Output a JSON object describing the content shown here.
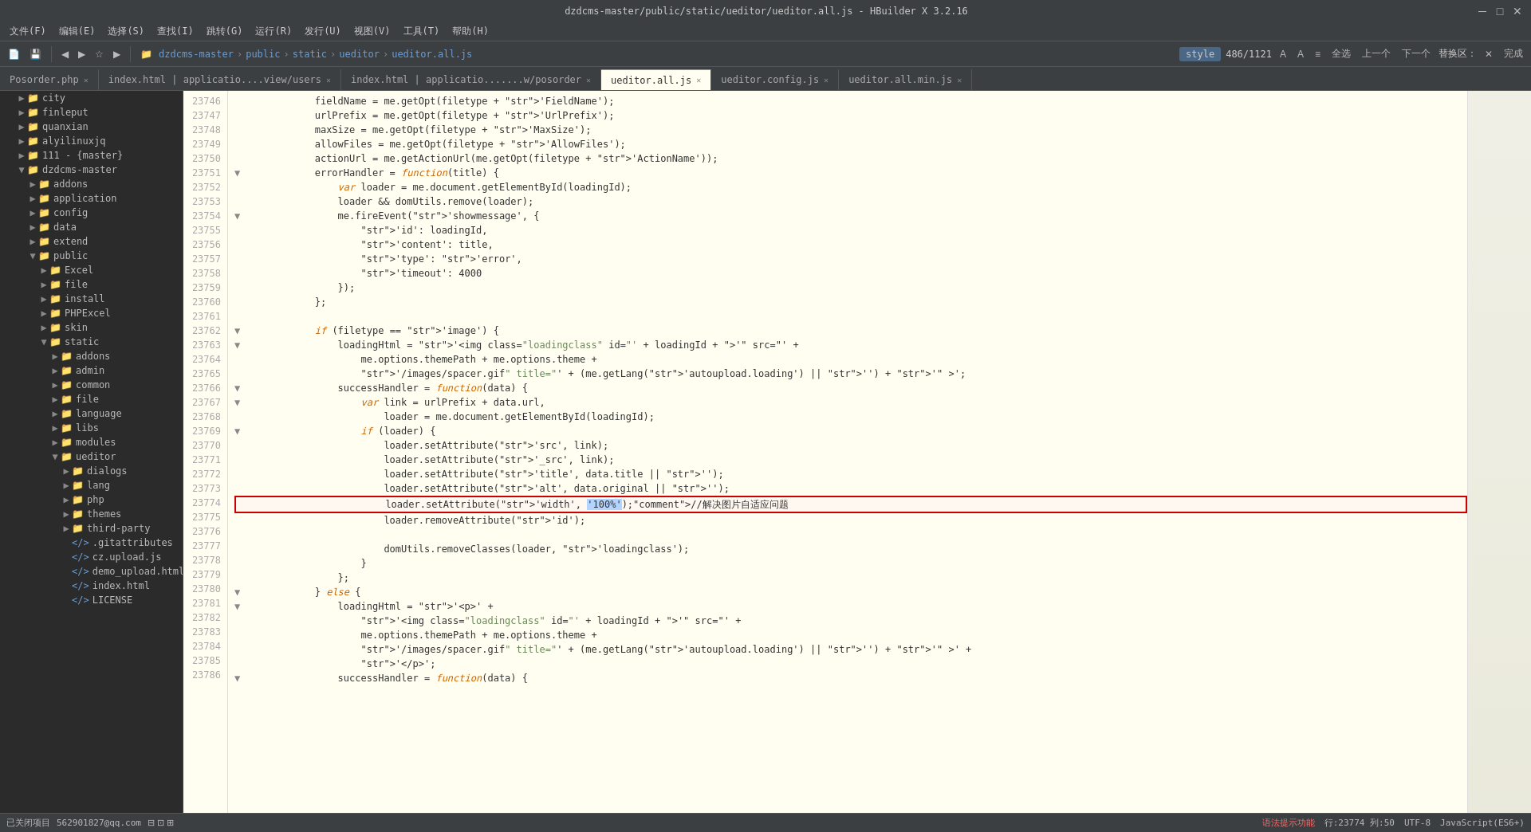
{
  "titleBar": {
    "title": "dzdcms-master/public/static/ueditor/ueditor.all.js - HBuilder X 3.2.16",
    "minimize": "─",
    "maximize": "□",
    "close": "✕"
  },
  "menuBar": {
    "items": [
      "文件(F)",
      "编辑(E)",
      "选择(S)",
      "查找(I)",
      "跳转(G)",
      "运行(R)",
      "发行(U)",
      "视图(V)",
      "工具(T)",
      "帮助(H)"
    ]
  },
  "toolbar": {
    "breadcrumb": [
      "dzdcms-master",
      "public",
      "static",
      "ueditor",
      "ueditor.all.js"
    ],
    "style_tab": "style",
    "position": "486/1121",
    "search_label": "全选",
    "prev_label": "上一个",
    "next_label": "下一个",
    "replace_label": "替换区：",
    "close_label": "✕",
    "finish_label": "完成"
  },
  "tabs": [
    {
      "label": "Posorder.php",
      "active": false
    },
    {
      "label": "index.html | applicatio....view/users",
      "active": false
    },
    {
      "label": "index.html | applicatio.......w/posorder",
      "active": false
    },
    {
      "label": "ueditor.all.js",
      "active": true
    },
    {
      "label": "ueditor.config.js",
      "active": false
    },
    {
      "label": "ueditor.all.min.js",
      "active": false
    }
  ],
  "sidebar": {
    "items": [
      {
        "indent": 1,
        "type": "folder",
        "open": false,
        "label": "city"
      },
      {
        "indent": 1,
        "type": "folder",
        "open": false,
        "label": "finleput"
      },
      {
        "indent": 1,
        "type": "folder",
        "open": false,
        "label": "quanxian"
      },
      {
        "indent": 1,
        "type": "folder",
        "open": false,
        "label": "alyilinuxjq"
      },
      {
        "indent": 1,
        "type": "folder",
        "open": false,
        "label": "111 - {master}"
      },
      {
        "indent": 1,
        "type": "folder",
        "open": true,
        "label": "dzdcms-master"
      },
      {
        "indent": 2,
        "type": "folder",
        "open": false,
        "label": "addons"
      },
      {
        "indent": 2,
        "type": "folder",
        "open": false,
        "label": "application"
      },
      {
        "indent": 2,
        "type": "folder",
        "open": false,
        "label": "config"
      },
      {
        "indent": 2,
        "type": "folder",
        "open": false,
        "label": "data"
      },
      {
        "indent": 2,
        "type": "folder",
        "open": false,
        "label": "extend"
      },
      {
        "indent": 2,
        "type": "folder",
        "open": true,
        "label": "public"
      },
      {
        "indent": 3,
        "type": "folder",
        "open": false,
        "label": "Excel"
      },
      {
        "indent": 3,
        "type": "folder",
        "open": false,
        "label": "file"
      },
      {
        "indent": 3,
        "type": "folder",
        "open": false,
        "label": "install"
      },
      {
        "indent": 3,
        "type": "folder",
        "open": false,
        "label": "PHPExcel"
      },
      {
        "indent": 3,
        "type": "folder",
        "open": false,
        "label": "skin"
      },
      {
        "indent": 3,
        "type": "folder",
        "open": true,
        "label": "static"
      },
      {
        "indent": 4,
        "type": "folder",
        "open": false,
        "label": "addons"
      },
      {
        "indent": 4,
        "type": "folder",
        "open": false,
        "label": "admin"
      },
      {
        "indent": 4,
        "type": "folder",
        "open": false,
        "label": "common"
      },
      {
        "indent": 4,
        "type": "folder",
        "open": false,
        "label": "file"
      },
      {
        "indent": 4,
        "type": "folder",
        "open": false,
        "label": "language"
      },
      {
        "indent": 4,
        "type": "folder",
        "open": false,
        "label": "libs"
      },
      {
        "indent": 4,
        "type": "folder",
        "open": false,
        "label": "modules"
      },
      {
        "indent": 4,
        "type": "folder",
        "open": true,
        "label": "ueditor"
      },
      {
        "indent": 5,
        "type": "folder",
        "open": false,
        "label": "dialogs"
      },
      {
        "indent": 5,
        "type": "folder",
        "open": false,
        "label": "lang"
      },
      {
        "indent": 5,
        "type": "folder",
        "open": false,
        "label": "php"
      },
      {
        "indent": 5,
        "type": "folder",
        "open": false,
        "label": "themes"
      },
      {
        "indent": 5,
        "type": "folder",
        "open": false,
        "label": "third-party"
      },
      {
        "indent": 5,
        "type": "file",
        "open": false,
        "label": ".gitattributes"
      },
      {
        "indent": 5,
        "type": "file",
        "open": false,
        "label": "cz.upload.js"
      },
      {
        "indent": 5,
        "type": "file",
        "open": false,
        "label": "demo_upload.html"
      },
      {
        "indent": 5,
        "type": "file",
        "open": false,
        "label": "index.html"
      },
      {
        "indent": 5,
        "type": "file",
        "open": false,
        "label": "LICENSE"
      }
    ]
  },
  "code": {
    "startLine": 23746,
    "lines": [
      {
        "num": "23746",
        "fold": false,
        "content": "            fieldName = me.getOpt(filetype + 'FieldName');",
        "highlight": false
      },
      {
        "num": "23747",
        "fold": false,
        "content": "            urlPrefix = me.getOpt(filetype + 'UrlPrefix');",
        "highlight": false
      },
      {
        "num": "23748",
        "fold": false,
        "content": "            maxSize = me.getOpt(filetype + 'MaxSize');",
        "highlight": false
      },
      {
        "num": "23749",
        "fold": false,
        "content": "            allowFiles = me.getOpt(filetype + 'AllowFiles');",
        "highlight": false
      },
      {
        "num": "23750",
        "fold": false,
        "content": "            actionUrl = me.getActionUrl(me.getOpt(filetype + 'ActionName'));",
        "highlight": false
      },
      {
        "num": "23751",
        "fold": true,
        "content": "            errorHandler = function(title) {",
        "highlight": false
      },
      {
        "num": "23752",
        "fold": false,
        "content": "                var loader = me.document.getElementById(loadingId);",
        "highlight": false
      },
      {
        "num": "23753",
        "fold": false,
        "content": "                loader && domUtils.remove(loader);",
        "highlight": false
      },
      {
        "num": "23754",
        "fold": true,
        "content": "                me.fireEvent('showmessage', {",
        "highlight": false
      },
      {
        "num": "23755",
        "fold": false,
        "content": "                    'id': loadingId,",
        "highlight": false
      },
      {
        "num": "23756",
        "fold": false,
        "content": "                    'content': title,",
        "highlight": false
      },
      {
        "num": "23757",
        "fold": false,
        "content": "                    'type': 'error',",
        "highlight": false
      },
      {
        "num": "23758",
        "fold": false,
        "content": "                    'timeout': 4000",
        "highlight": false
      },
      {
        "num": "23759",
        "fold": false,
        "content": "                });",
        "highlight": false
      },
      {
        "num": "23760",
        "fold": false,
        "content": "            };",
        "highlight": false
      },
      {
        "num": "23761",
        "fold": false,
        "content": "",
        "highlight": false
      },
      {
        "num": "23762",
        "fold": true,
        "content": "            if (filetype == 'image') {",
        "highlight": false
      },
      {
        "num": "23763",
        "fold": true,
        "content": "                loadingHtml = '<img class=\"loadingclass\" id=\"' + loadingId + '\" src=\"' +",
        "highlight": false
      },
      {
        "num": "23764",
        "fold": false,
        "content": "                    me.options.themePath + me.options.theme +",
        "highlight": false
      },
      {
        "num": "23765",
        "fold": false,
        "content": "                    '/images/spacer.gif\" title=\"' + (me.getLang('autoupload.loading') || '') + '\" >';",
        "highlight": false
      },
      {
        "num": "23766",
        "fold": true,
        "content": "                successHandler = function(data) {",
        "highlight": false
      },
      {
        "num": "23767",
        "fold": true,
        "content": "                    var link = urlPrefix + data.url,",
        "highlight": false
      },
      {
        "num": "23768",
        "fold": false,
        "content": "                        loader = me.document.getElementById(loadingId);",
        "highlight": false
      },
      {
        "num": "23769",
        "fold": true,
        "content": "                    if (loader) {",
        "highlight": false
      },
      {
        "num": "23770",
        "fold": false,
        "content": "                        loader.setAttribute('src', link);",
        "highlight": false
      },
      {
        "num": "23771",
        "fold": false,
        "content": "                        loader.setAttribute('_src', link);",
        "highlight": false
      },
      {
        "num": "23772",
        "fold": false,
        "content": "                        loader.setAttribute('title', data.title || '');",
        "highlight": false
      },
      {
        "num": "23773",
        "fold": false,
        "content": "                        loader.setAttribute('alt', data.original || '');",
        "highlight": false
      },
      {
        "num": "23774",
        "fold": false,
        "content": "                        loader.setAttribute('width', '100%');//解决图片自适应问题",
        "highlight": true,
        "selected": true
      },
      {
        "num": "23775",
        "fold": false,
        "content": "                        loader.removeAttribute('id');",
        "highlight": false
      },
      {
        "num": "23776",
        "fold": false,
        "content": "",
        "highlight": false
      },
      {
        "num": "23777",
        "fold": false,
        "content": "                        domUtils.removeClasses(loader, 'loadingclass');",
        "highlight": false
      },
      {
        "num": "23778",
        "fold": false,
        "content": "                    }",
        "highlight": false
      },
      {
        "num": "23779",
        "fold": false,
        "content": "                };",
        "highlight": false
      },
      {
        "num": "23780",
        "fold": true,
        "content": "            } else {",
        "highlight": false
      },
      {
        "num": "23781",
        "fold": true,
        "content": "                loadingHtml = '<p>' +",
        "highlight": false
      },
      {
        "num": "23782",
        "fold": false,
        "content": "                    '<img class=\"loadingclass\" id=\"' + loadingId + '\" src=\"' +",
        "highlight": false
      },
      {
        "num": "23783",
        "fold": false,
        "content": "                    me.options.themePath + me.options.theme +",
        "highlight": false
      },
      {
        "num": "23784",
        "fold": false,
        "content": "                    '/images/spacer.gif\" title=\"' + (me.getLang('autoupload.loading') || '') + '\" >' +",
        "highlight": false
      },
      {
        "num": "23785",
        "fold": false,
        "content": "                    '</p>';",
        "highlight": false
      },
      {
        "num": "23786",
        "fold": true,
        "content": "                successHandler = function(data) {",
        "highlight": false
      }
    ]
  },
  "statusBar": {
    "closed_projects": "已关闭项目",
    "qq": "562901827@qq.com",
    "warning": "语法提示功能",
    "line_col": "行:23774  列:50",
    "encoding": "UTF-8",
    "syntax": "JavaScript(ES6+)"
  }
}
